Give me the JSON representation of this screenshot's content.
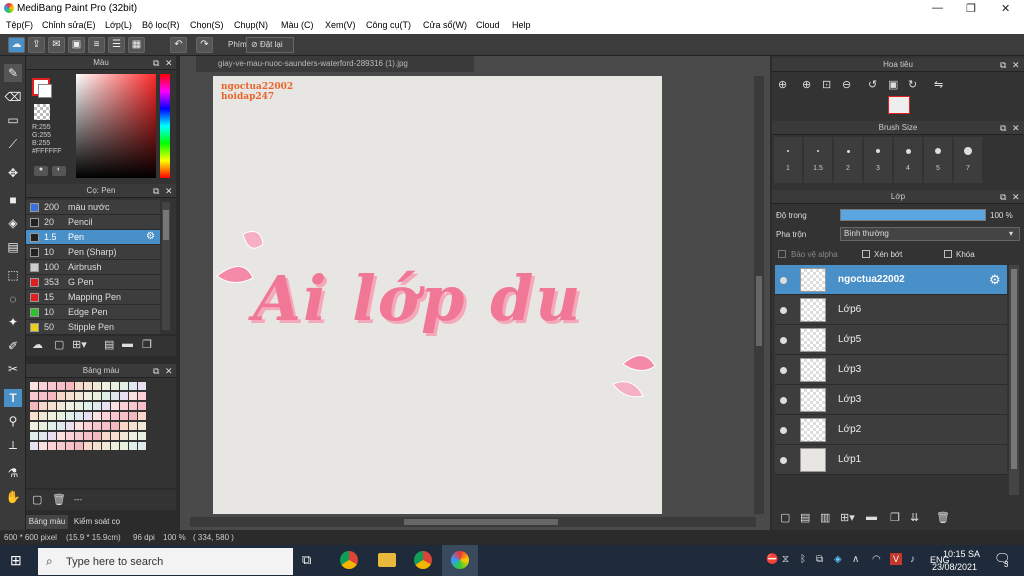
{
  "app": {
    "title": "MediBang Paint Pro (32bit)"
  },
  "menu": [
    "Tệp(F)",
    "Chỉnh sửa(E)",
    "Lớp(L)",
    "Bộ lọc(R)",
    "Chọn(S)",
    "Chụp(N)",
    "Màu (C)",
    "Xem(V)",
    "Công cụ(T)",
    "Cửa sổ(W)",
    "Cloud",
    "Help"
  ],
  "toolbar": {
    "shortcut_label": "Phím",
    "reset_label": "Đặt lại"
  },
  "color_panel": {
    "title": "Màu",
    "rgb": "R:255\nG:255\nB:255",
    "hex": "#FFFFFF",
    "primary_color": "#ffffff",
    "secondary_color": "#e02020"
  },
  "brush_panel": {
    "title": "Cọ: Pen",
    "brushes": [
      {
        "size": "200",
        "name": "màu nước",
        "color": "#3b6fe0"
      },
      {
        "size": "20",
        "name": "Pencil",
        "color": "#222222"
      },
      {
        "size": "1.5",
        "name": "Pen",
        "color": "#222222"
      },
      {
        "size": "10",
        "name": "Pen (Sharp)",
        "color": "#222222"
      },
      {
        "size": "100",
        "name": "Airbrush",
        "color": "#cccccc"
      },
      {
        "size": "353",
        "name": "G Pen",
        "color": "#e02020"
      },
      {
        "size": "15",
        "name": "Mapping Pen",
        "color": "#e02020"
      },
      {
        "size": "10",
        "name": "Edge Pen",
        "color": "#2fbf2f"
      },
      {
        "size": "50",
        "name": "Stipple Pen",
        "color": "#e8d020"
      }
    ]
  },
  "palette_panel": {
    "title": "Bảng màu",
    "tab1": "Bảng màu",
    "tab2": "Kiểm soát cọ",
    "search_placeholder": "---"
  },
  "canvas": {
    "tab_title": "giay-ve-mau-nuoc-saunders-waterford-289316 (1).jpg",
    "watermark1": "ngoctua22002",
    "watermark2": "hoidap247",
    "artwork_text": "Ai lớp du"
  },
  "navigator": {
    "title": "Hoa tiêu"
  },
  "brush_size": {
    "title": "Brush Size",
    "sizes": [
      "1",
      "1.5",
      "2",
      "3",
      "4",
      "5",
      "7"
    ]
  },
  "layer_panel": {
    "title": "Lớp",
    "opacity_label": "Độ trong",
    "opacity_value": "100 %",
    "blend_label": "Pha trộn",
    "blend_value": "Bình thường",
    "protect_alpha": "Bảo vệ alpha",
    "clipping": "Xén bớt",
    "lock": "Khóa",
    "layers": [
      "ngoctua22002",
      "Lớp6",
      "Lớp5",
      "Lớp3",
      "Lớp3",
      "Lớp2",
      "Lớp1"
    ]
  },
  "status": {
    "size": "600 * 600 pixel",
    "cm": "(15.9 * 15.9cm)",
    "dpi": "96 dpi",
    "zoom": "100 %",
    "coords": "( 334, 580 )"
  },
  "taskbar": {
    "search_placeholder": "Type here to search",
    "lang": "ENG",
    "time": "10:15 SA",
    "date": "23/08/2021",
    "notif": "3"
  }
}
